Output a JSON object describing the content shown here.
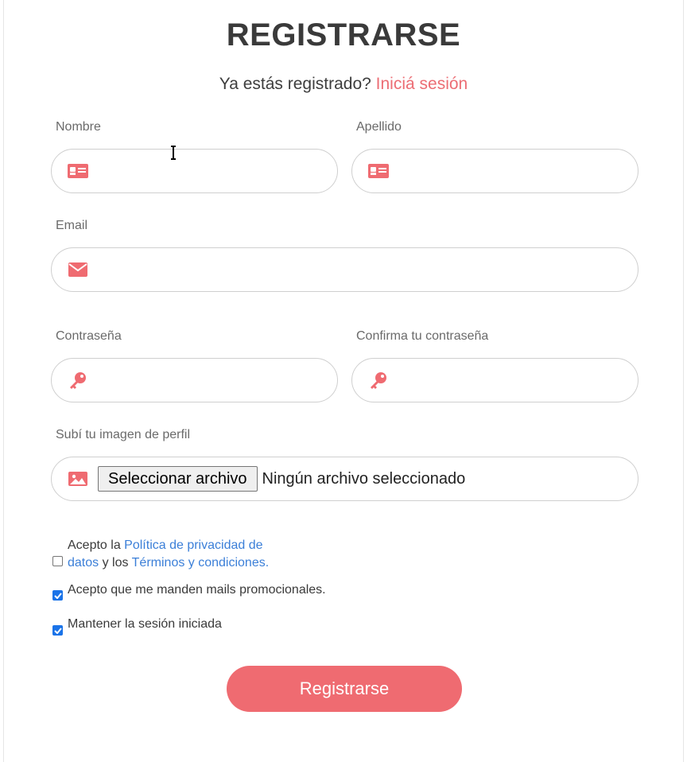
{
  "header": {
    "title": "REGISTRARSE",
    "login_prompt": "Ya estás registrado?",
    "login_link": "Iniciá sesión"
  },
  "form": {
    "first_name": {
      "label": "Nombre",
      "value": "",
      "icon": "id-card-icon"
    },
    "last_name": {
      "label": "Apellido",
      "value": "",
      "icon": "id-card-icon"
    },
    "email": {
      "label": "Email",
      "value": "",
      "icon": "envelope-icon"
    },
    "password": {
      "label": "Contraseña",
      "value": "",
      "icon": "key-icon"
    },
    "password_confirm": {
      "label": "Confirma tu contraseña",
      "value": "",
      "icon": "key-icon"
    },
    "avatar": {
      "label": "Subí tu imagen de perfil",
      "button_label": "Seleccionar archivo",
      "status": "Ningún archivo seleccionado",
      "icon": "image-icon"
    }
  },
  "checkboxes": {
    "terms": {
      "checked": false,
      "text_1": "Acepto la",
      "privacy_link": "Política de privacidad de",
      "privacy_link_2": "datos",
      "text_2": "y los",
      "terms_link": "Términos y condiciones."
    },
    "promo": {
      "checked": true,
      "label": "Acepto que me manden mails promocionales."
    },
    "remember": {
      "checked": true,
      "label": "Mantener la sesión iniciada"
    }
  },
  "submit": {
    "label": "Registrarse"
  },
  "colors": {
    "accent": "#ef6b71",
    "link": "#3b7fd8",
    "checkbox": "#1a73e8"
  }
}
